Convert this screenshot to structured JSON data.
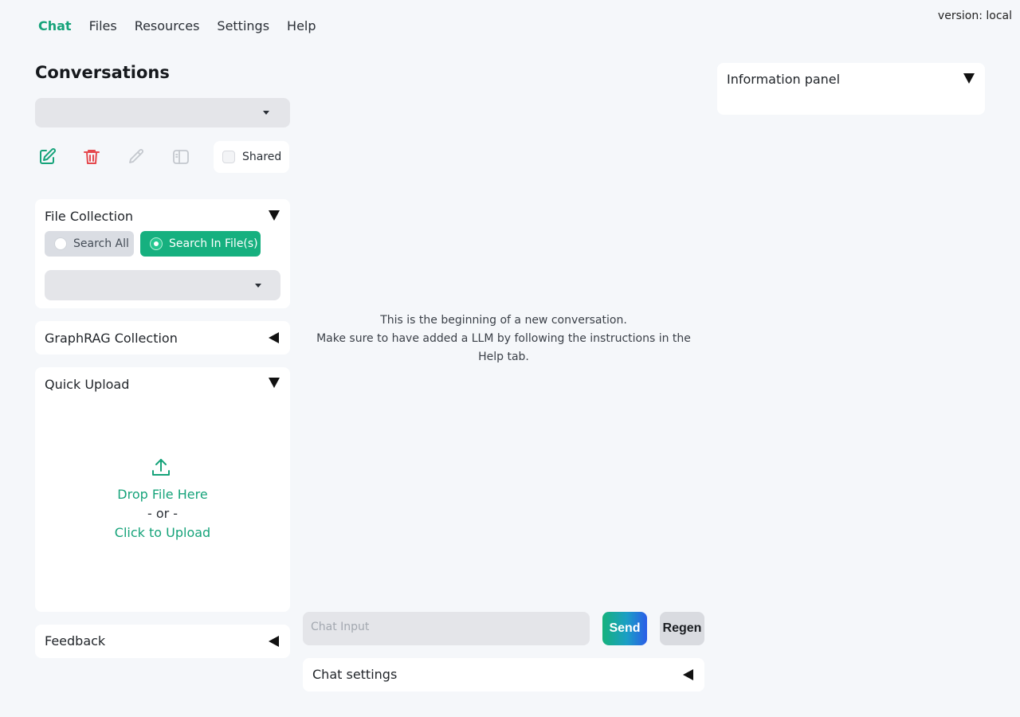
{
  "nav": {
    "tabs": [
      {
        "label": "Chat",
        "active": true
      },
      {
        "label": "Files"
      },
      {
        "label": "Resources"
      },
      {
        "label": "Settings"
      },
      {
        "label": "Help"
      }
    ]
  },
  "version": "version: local",
  "sidebar": {
    "conversations_title": "Conversations",
    "conversation_select_value": "",
    "actions": {
      "new_icon": "edit-square-icon",
      "delete_icon": "trash-icon",
      "rename_icon": "pencil-icon",
      "toggle_icon": "sidebar-toggle-icon"
    },
    "shared_label": "Shared",
    "shared_checked": false,
    "file_collection": {
      "title": "File Collection",
      "options": [
        "Search All",
        "Search In File(s)"
      ],
      "selected": "Search In File(s)",
      "file_select_value": ""
    },
    "graphrag": {
      "title": "GraphRAG Collection"
    },
    "quick_upload": {
      "title": "Quick Upload",
      "icon": "upload-icon",
      "drop_text": "Drop File Here",
      "or_text": "- or -",
      "click_text": "Click to Upload"
    },
    "feedback": {
      "title": "Feedback"
    }
  },
  "chat": {
    "empty_line1": "This is the beginning of a new conversation.",
    "empty_line2": "Make sure to have added a LLM by following the instructions in the Help tab.",
    "input_placeholder": "Chat Input",
    "send_label": "Send",
    "regen_label": "Regen",
    "settings_title": "Chat settings"
  },
  "info_panel": {
    "title": "Information panel"
  },
  "colors": {
    "accent": "#16a37a",
    "danger": "#e5484d",
    "background": "#f5f7fa"
  }
}
